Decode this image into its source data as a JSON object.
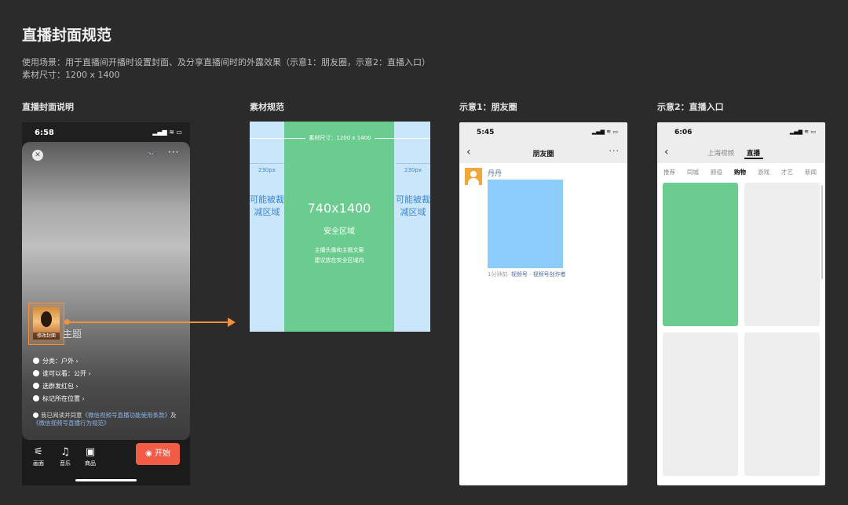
{
  "title": "直播封面规范",
  "desc_line1": "使用场景：用于直播间开播时设置封面、及分享直播间时的外露效果（示意1：朋友圈，示意2：直播入口）",
  "desc_line2": "素材尺寸：1200 x 1400",
  "columns": {
    "c1": "直播封面说明",
    "c2": "素材规范",
    "c3": "示意1：朋友圈",
    "c4": "示意2：直播入口"
  },
  "phone1": {
    "time": "6:58",
    "status_icons": "▂▄▆ ≋ ▭",
    "close_glyph": "✕",
    "game_glyph": "🎮",
    "more_glyph": "···",
    "cover_label": "修改封面",
    "topic": "主题",
    "menu": [
      {
        "label": "分类：户外 ›"
      },
      {
        "label": "谁可以看：公开 ›"
      },
      {
        "label": "选群发红包 ›"
      },
      {
        "label": "标记所在位置 ›"
      }
    ],
    "agree_text": "我已阅读并同意",
    "agree_link1": "《微信视频号直播功能使用条款》",
    "agree_and": "及",
    "agree_link2": "《微信视频号直播行为规范》",
    "tools": [
      {
        "glyph": "⚟",
        "label": "画面"
      },
      {
        "glyph": "♫",
        "label": "音乐"
      },
      {
        "glyph": "▣",
        "label": "商品"
      }
    ],
    "start_label": "◉ 开始"
  },
  "spec": {
    "size_label": "素材尺寸：1200 x 1400",
    "left_px": "230px",
    "right_px": "230px",
    "side_text": "可能被裁减区域",
    "safe_size": "740x1400",
    "safe_label": "安全区域",
    "note_line1": "主播头像和主题文案",
    "note_line2": "建议放在安全区域内"
  },
  "phone2": {
    "time": "5:45",
    "status_icons": "▂▄▆ ≋ ▭",
    "back_glyph": "‹",
    "nav_title": "朋友圈",
    "more_glyph": "···",
    "user_name": "丹丹",
    "meta_time": "1分钟前",
    "meta_source": "视频号 · 视频号创作者"
  },
  "phone3": {
    "time": "6:06",
    "status_icons": "▂▄▆ ≋ ▭",
    "back_glyph": "‹",
    "tab_city": "上海视频",
    "tab_live": "直播",
    "channels": [
      "推荐",
      "同城",
      "颜值",
      "购物",
      "游戏",
      "才艺",
      "新闻"
    ],
    "active_channel": "购物"
  }
}
